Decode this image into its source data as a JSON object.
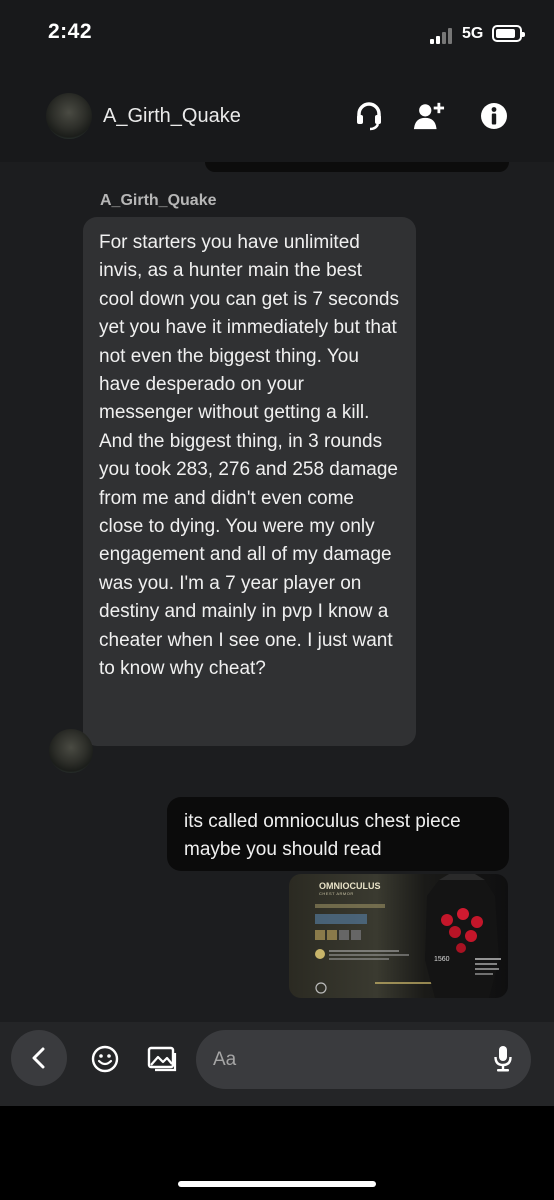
{
  "status": {
    "time": "2:42",
    "network": "5G"
  },
  "header": {
    "name": "A_Girth_Quake",
    "icons": [
      "headset-icon",
      "add-user-icon",
      "info-icon"
    ]
  },
  "messages": [
    {
      "sender": "A_Girth_Quake",
      "direction": "incoming",
      "text": "For starters you have unlimited invis, as a hunter main the best cool down you can get is 7 seconds yet you have it immediately but that not even the biggest thing. You have desperado on your messenger without getting a kill. And the biggest thing, in 3 rounds you took 283, 276 and 258 damage from me and didn't even come close to dying. You were my only engagement and all of my damage was you. I'm a 7 year player on destiny and mainly in pvp I know a cheater when I see one. I just want to know why cheat?"
    },
    {
      "direction": "outgoing",
      "text": "its called omnioculus chest piece maybe you should read"
    }
  ],
  "image_message": {
    "title": "OMNIOCULUS",
    "subtitle": "CHEST ARMOR",
    "power": "1560"
  },
  "composer": {
    "placeholder": "Aa"
  },
  "colors": {
    "background": "#1c1d1f",
    "incoming_bubble": "#303133",
    "outgoing_bubble": "#0b0b0b",
    "composer": "#242527"
  }
}
